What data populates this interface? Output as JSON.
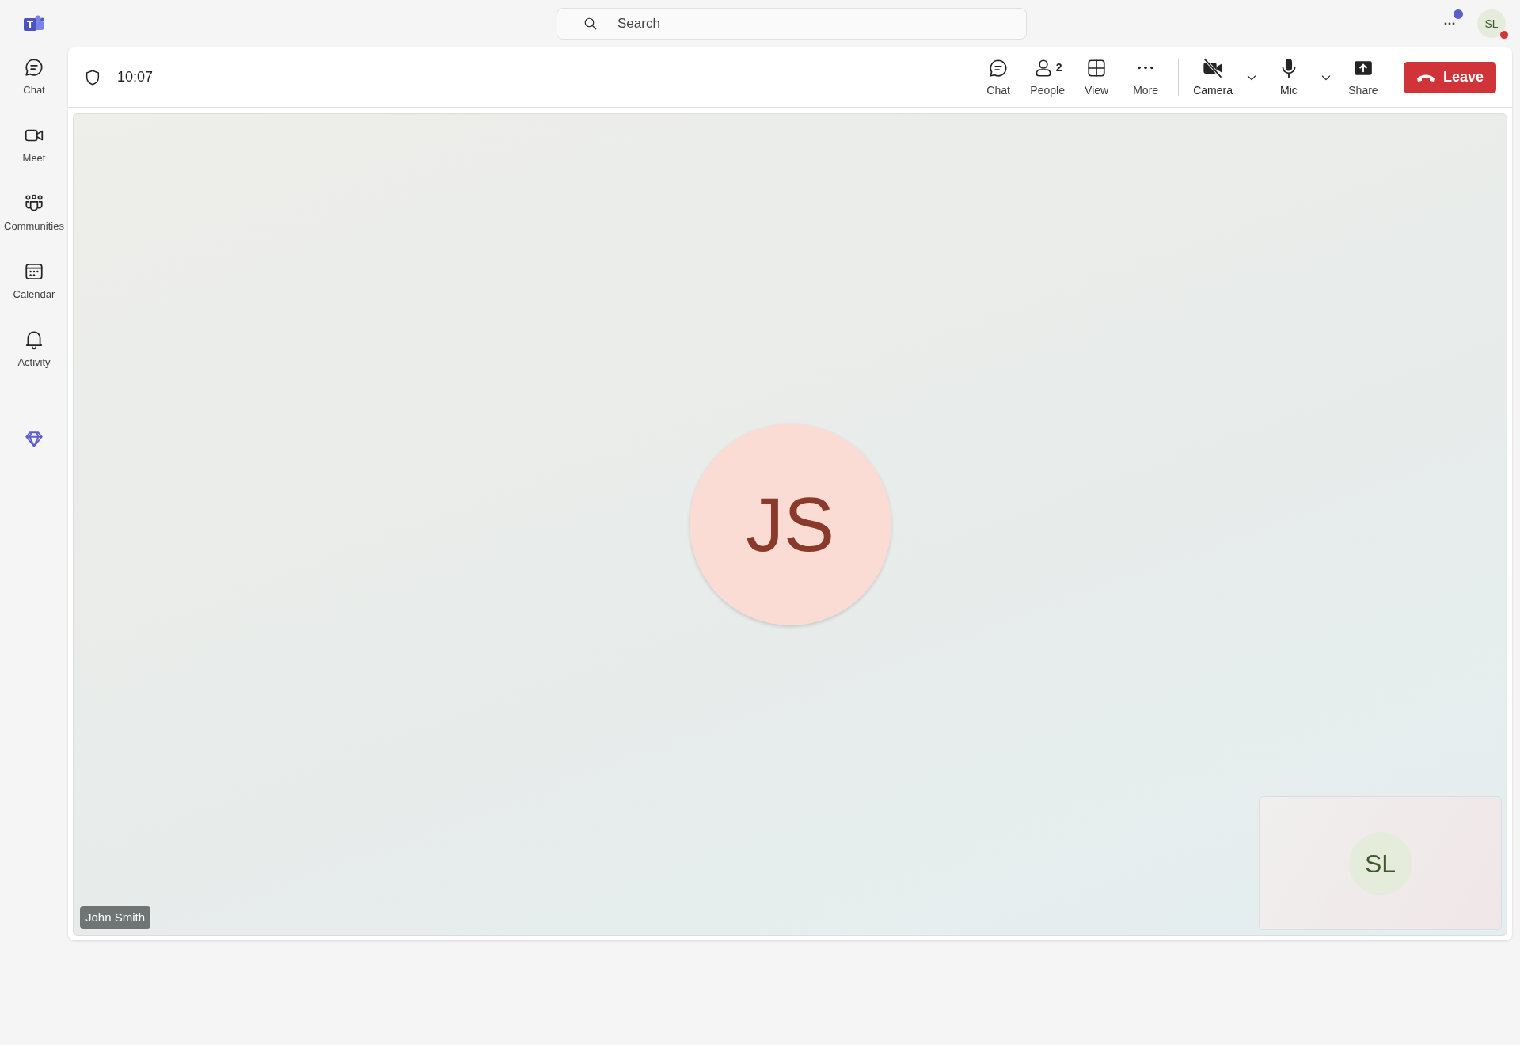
{
  "top_bar": {
    "search": {
      "placeholder": "Search"
    },
    "profile": {
      "initials": "SL"
    }
  },
  "sidebar": {
    "items": [
      {
        "label": "Chat"
      },
      {
        "label": "Meet"
      },
      {
        "label": "Communities"
      },
      {
        "label": "Calendar"
      },
      {
        "label": "Activity"
      }
    ]
  },
  "meeting": {
    "time": "10:07",
    "toolbar": [
      {
        "kind": "action",
        "label": "Chat"
      },
      {
        "kind": "action",
        "label": "People",
        "count": "2"
      },
      {
        "kind": "action",
        "label": "View"
      },
      {
        "kind": "action",
        "label": "More"
      },
      {
        "kind": "divider"
      },
      {
        "kind": "device",
        "label": "Camera",
        "on": false
      },
      {
        "kind": "device",
        "label": "Mic",
        "on": true
      },
      {
        "kind": "action",
        "label": "Share"
      },
      {
        "kind": "leave",
        "label": "Leave"
      }
    ],
    "participant": {
      "initials": "JS",
      "name": "John Smith"
    },
    "self_view": {
      "initials": "SL"
    }
  }
}
